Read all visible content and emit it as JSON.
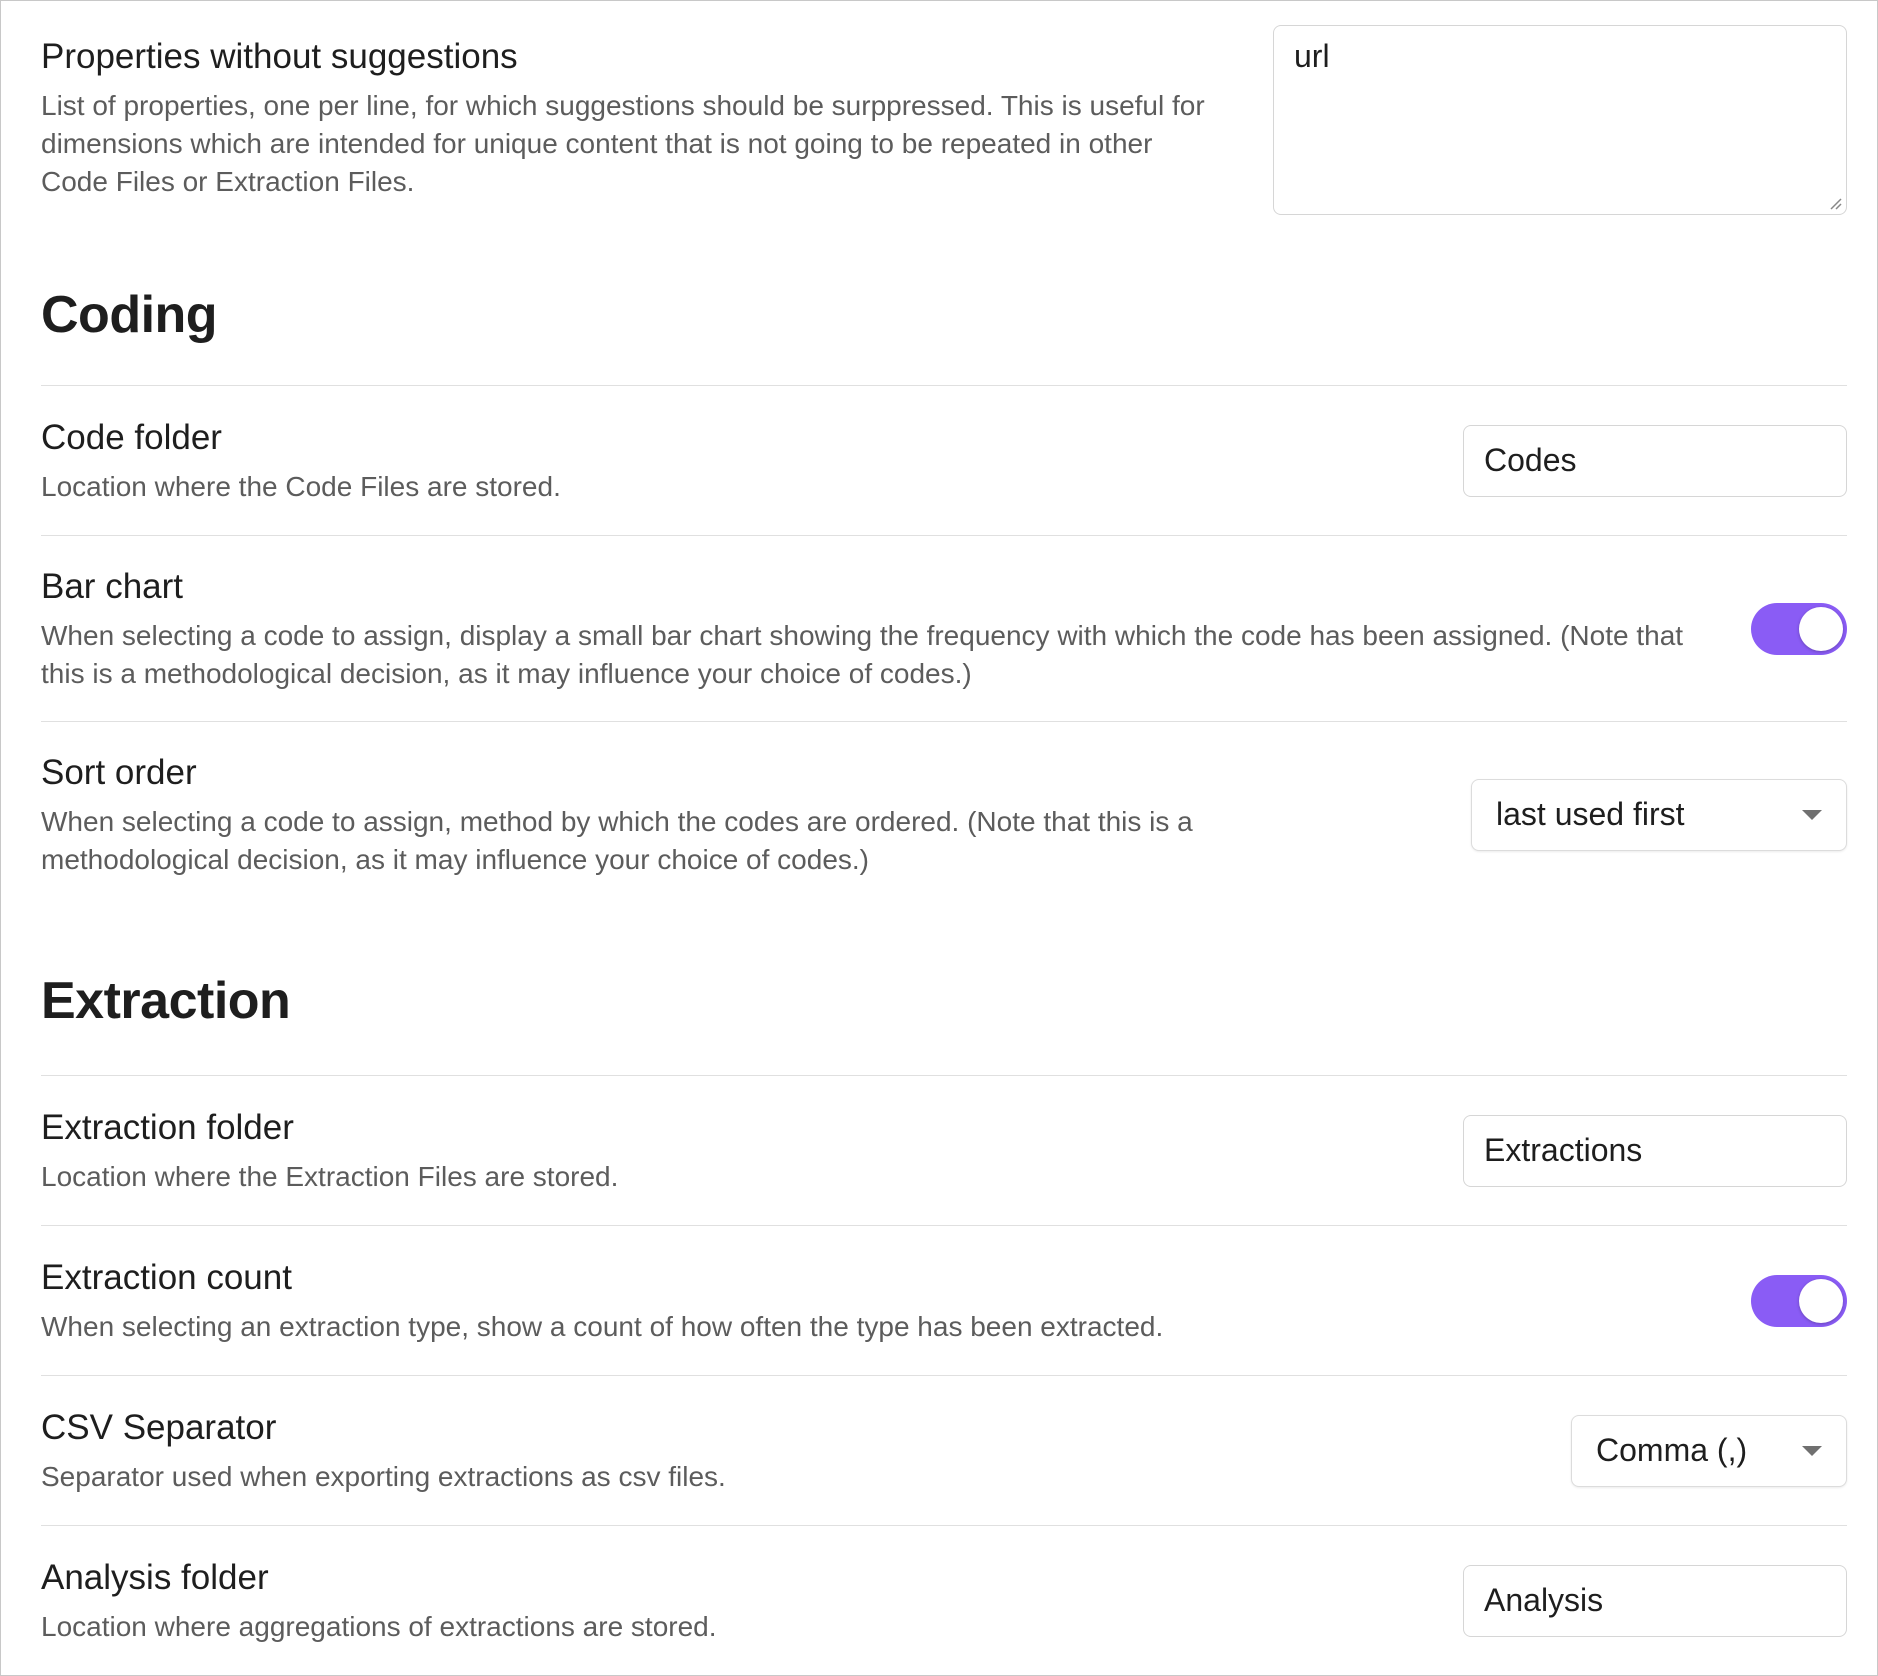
{
  "properties_without_suggestions": {
    "name": "Properties without suggestions",
    "description": "List of properties, one per line, for which suggestions should be surppressed. This is useful for dimensions which are intended for unique content that is not going to be repeated in other Code Files or Extraction Files.",
    "value": "url"
  },
  "coding": {
    "heading": "Coding",
    "code_folder": {
      "name": "Code folder",
      "description": "Location where the Code Files are stored.",
      "value": "Codes"
    },
    "bar_chart": {
      "name": "Bar chart",
      "description": "When selecting a code to assign, display a small bar chart showing the frequency with which the code has been assigned. (Note that this is a methodological decision, as it may influence your choice of codes.)",
      "enabled": true
    },
    "sort_order": {
      "name": "Sort order",
      "description": "When selecting a code to assign, method by which the codes are ordered. (Note that this is a methodological decision, as it may influence your choice of codes.)",
      "selected": "last used first"
    }
  },
  "extraction": {
    "heading": "Extraction",
    "extraction_folder": {
      "name": "Extraction folder",
      "description": "Location where the Extraction Files are stored.",
      "value": "Extractions"
    },
    "extraction_count": {
      "name": "Extraction count",
      "description": "When selecting an extraction type, show a count of how often the type has been extracted.",
      "enabled": true
    },
    "csv_separator": {
      "name": "CSV Separator",
      "description": "Separator used when exporting extractions as csv files.",
      "selected": "Comma (,)"
    },
    "analysis_folder": {
      "name": "Analysis folder",
      "description": "Location where aggregations of extractions are stored.",
      "value": "Analysis"
    }
  },
  "colors": {
    "accent": "#8a5cf5",
    "text_primary": "#1e1e1e",
    "text_muted": "#5c5c5c",
    "divider": "#e0e0e0"
  },
  "icons": {
    "dropdown": "chevron-down-icon",
    "resize": "resize-grip-icon"
  }
}
